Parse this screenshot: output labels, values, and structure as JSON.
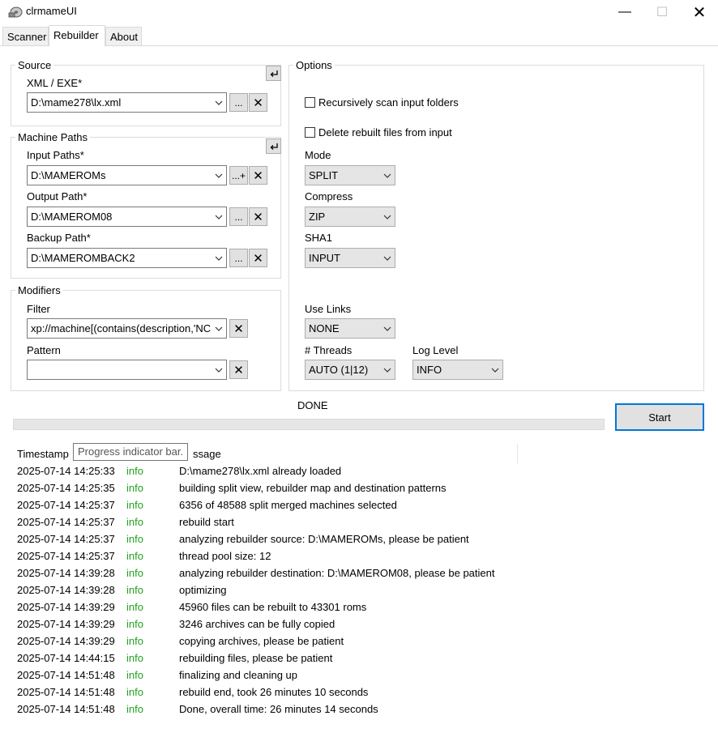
{
  "window": {
    "title": "clrmameUI",
    "min_glyph": "—",
    "max_glyph": "☐",
    "close_glyph": "✕"
  },
  "tabs": [
    {
      "label": "Scanner"
    },
    {
      "label": "Rebuilder"
    },
    {
      "label": "About"
    }
  ],
  "source": {
    "group_label": "Source",
    "xml_label": "XML / EXE*",
    "xml_value": "D:\\mame278\\lx.xml",
    "browse_label": "...",
    "clear_glyph": "✕"
  },
  "machine_paths": {
    "group_label": "Machine Paths",
    "input_label": "Input Paths*",
    "input_value": "D:\\MAMEROMs",
    "input_add_label": "...+",
    "output_label": "Output Path*",
    "output_value": "D:\\MAMEROM08",
    "backup_label": "Backup Path*",
    "backup_value": "D:\\MAMEROMBACK2",
    "browse_label": "...",
    "clear_glyph": "✕"
  },
  "modifiers": {
    "group_label": "Modifiers",
    "filter_label": "Filter",
    "filter_value": "xp://machine[(contains(description,'NC",
    "pattern_label": "Pattern",
    "pattern_value": "",
    "clear_glyph": "✕"
  },
  "options": {
    "group_label": "Options",
    "recursive_label": "Recursively scan input folders",
    "recursive_checked": false,
    "delete_label": "Delete rebuilt files from input",
    "delete_checked": false,
    "mode_label": "Mode",
    "mode_value": "SPLIT",
    "compress_label": "Compress",
    "compress_value": "ZIP",
    "sha1_label": "SHA1",
    "sha1_value": "INPUT",
    "links_label": "Use Links",
    "links_value": "NONE",
    "threads_label": "# Threads",
    "threads_value": "AUTO (1|12)",
    "loglevel_label": "Log Level",
    "loglevel_value": "INFO"
  },
  "status": {
    "text": "DONE",
    "start_label": "Start",
    "progress": 0,
    "tooltip": "Progress indicator bar."
  },
  "log": {
    "headers": {
      "timestamp": "Timestamp",
      "message": "ssage"
    },
    "rows": [
      {
        "ts": "2025-07-14 14:25:33",
        "level": "info",
        "msg": "D:\\mame278\\lx.xml already loaded"
      },
      {
        "ts": "2025-07-14 14:25:35",
        "level": "info",
        "msg": "building split view, rebuilder map and destination patterns"
      },
      {
        "ts": "2025-07-14 14:25:37",
        "level": "info",
        "msg": "6356 of 48588 split merged machines selected"
      },
      {
        "ts": "2025-07-14 14:25:37",
        "level": "info",
        "msg": "rebuild start"
      },
      {
        "ts": "2025-07-14 14:25:37",
        "level": "info",
        "msg": "analyzing rebuilder source: D:\\MAMEROMs, please be patient"
      },
      {
        "ts": "2025-07-14 14:25:37",
        "level": "info",
        "msg": "thread pool size: 12"
      },
      {
        "ts": "2025-07-14 14:39:28",
        "level": "info",
        "msg": "analyzing rebuilder destination: D:\\MAMEROM08, please be patient"
      },
      {
        "ts": "2025-07-14 14:39:28",
        "level": "info",
        "msg": "optimizing"
      },
      {
        "ts": "2025-07-14 14:39:29",
        "level": "info",
        "msg": "45960 files can be rebuilt to 43301 roms"
      },
      {
        "ts": "2025-07-14 14:39:29",
        "level": "info",
        "msg": "3246 archives can be fully copied"
      },
      {
        "ts": "2025-07-14 14:39:29",
        "level": "info",
        "msg": "copying archives, please be patient"
      },
      {
        "ts": "2025-07-14 14:44:15",
        "level": "info",
        "msg": "rebuilding files, please be patient"
      },
      {
        "ts": "2025-07-14 14:51:48",
        "level": "info",
        "msg": "finalizing and cleaning up"
      },
      {
        "ts": "2025-07-14 14:51:48",
        "level": "info",
        "msg": "rebuild end, took 26 minutes 10 seconds"
      },
      {
        "ts": "2025-07-14 14:51:48",
        "level": "info",
        "msg": "Done, overall time: 26 minutes 14 seconds"
      }
    ]
  },
  "colors": {
    "info_level": "#22a022",
    "accent": "#0078d7"
  }
}
